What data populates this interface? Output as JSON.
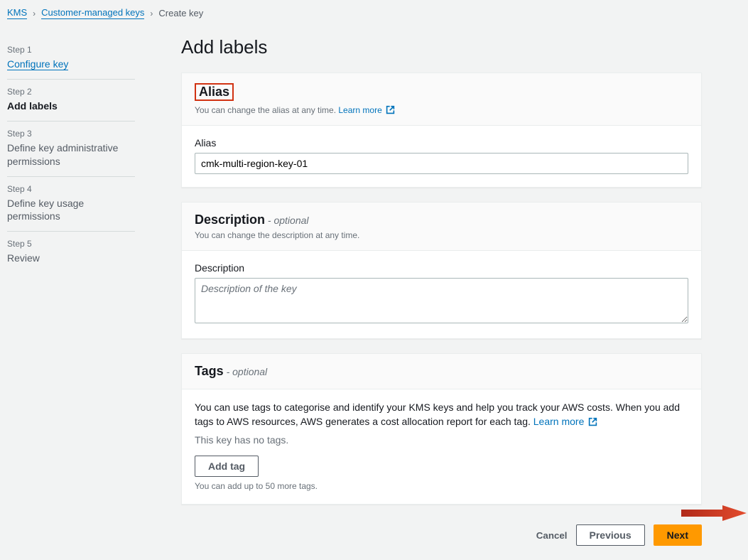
{
  "breadcrumb": {
    "kms": "KMS",
    "cmk": "Customer-managed keys",
    "current": "Create key"
  },
  "sidebar": {
    "steps": [
      {
        "label": "Step 1",
        "title": "Configure key"
      },
      {
        "label": "Step 2",
        "title": "Add labels"
      },
      {
        "label": "Step 3",
        "title": "Define key administrative permissions"
      },
      {
        "label": "Step 4",
        "title": "Define key usage permissions"
      },
      {
        "label": "Step 5",
        "title": "Review"
      }
    ]
  },
  "page": {
    "title": "Add labels"
  },
  "alias": {
    "heading": "Alias",
    "subtext": "You can change the alias at any time.",
    "learn_more": "Learn more",
    "field_label": "Alias",
    "value": "cmk-multi-region-key-01"
  },
  "description": {
    "heading": "Description",
    "optional": " - optional",
    "subtext": "You can change the description at any time.",
    "field_label": "Description",
    "placeholder": "Description of the key"
  },
  "tags": {
    "heading": "Tags",
    "optional": " - optional",
    "description": "You can use tags to categorise and identify your KMS keys and help you track your AWS costs. When you add tags to AWS resources, AWS generates a cost allocation report for each tag.",
    "learn_more": "Learn more",
    "empty": "This key has no tags.",
    "add_button": "Add tag",
    "note": "You can add up to 50 more tags."
  },
  "footer": {
    "cancel": "Cancel",
    "previous": "Previous",
    "next": "Next"
  }
}
